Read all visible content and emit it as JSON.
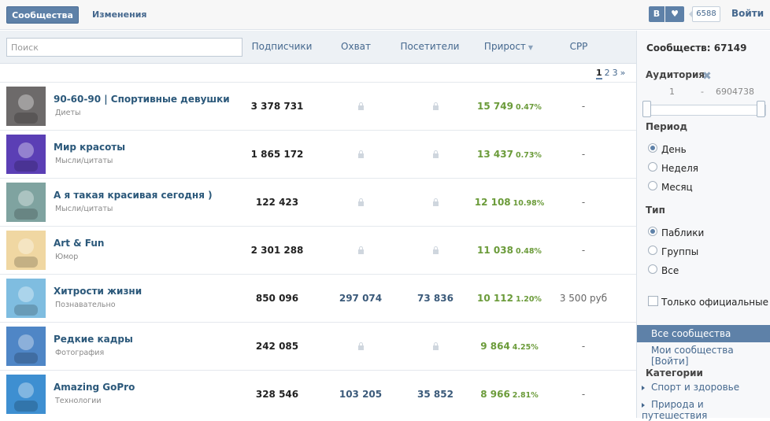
{
  "topbar": {
    "tab_communities": "Сообщества",
    "tab_changes": "Изменения",
    "vk_label": "В",
    "heart": "♥",
    "likes": "6588",
    "login": "Войти"
  },
  "table_header": {
    "search_placeholder": "Поиск",
    "col_subscribers": "Подписчики",
    "col_reach": "Охват",
    "col_visitors": "Посетители",
    "col_growth": "Прирост",
    "sort_indicator": "▼",
    "col_cpp": "CPP"
  },
  "pagination": {
    "pages": [
      "1",
      "2",
      "3"
    ],
    "next": "»",
    "current": "1"
  },
  "rows": [
    {
      "name": "90-60-90 | Спортивные девушки",
      "category": "Диеты",
      "subscribers": "3 378 731",
      "reach": "",
      "visitors": "",
      "growth": "15 749",
      "growth_pct": "0.47%",
      "cpp": "-",
      "thumb_color": "#6d6a6a"
    },
    {
      "name": "Мир красоты",
      "category": "Мысли/цитаты",
      "subscribers": "1 865 172",
      "reach": "",
      "visitors": "",
      "growth": "13 437",
      "growth_pct": "0.73%",
      "cpp": "-",
      "thumb_color": "#5b3fb5"
    },
    {
      "name": "А я такая красивая сегодня )",
      "category": "Мысли/цитаты",
      "subscribers": "122 423",
      "reach": "",
      "visitors": "",
      "growth": "12 108",
      "growth_pct": "10.98%",
      "cpp": "-",
      "thumb_color": "#7fa3a0"
    },
    {
      "name": "Art & Fun",
      "category": "Юмор",
      "subscribers": "2 301 288",
      "reach": "",
      "visitors": "",
      "growth": "11 038",
      "growth_pct": "0.48%",
      "cpp": "-",
      "thumb_color": "#f0d7a2"
    },
    {
      "name": "Хитрости жизни",
      "category": "Познавательно",
      "subscribers": "850 096",
      "reach": "297 074",
      "visitors": "73 836",
      "growth": "10 112",
      "growth_pct": "1.20%",
      "cpp": "3 500 руб",
      "thumb_color": "#7fbde0"
    },
    {
      "name": "Редкие кадры",
      "category": "Фотография",
      "subscribers": "242 085",
      "reach": "",
      "visitors": "",
      "growth": "9 864",
      "growth_pct": "4.25%",
      "cpp": "-",
      "thumb_color": "#4f86c6"
    },
    {
      "name": "Amazing GoPro",
      "category": "Технологии",
      "subscribers": "328 546",
      "reach": "103 205",
      "visitors": "35 852",
      "growth": "8 966",
      "growth_pct": "2.81%",
      "cpp": "-",
      "thumb_color": "#3e8fd1"
    }
  ],
  "sidebar": {
    "total": "Сообществ: 67149",
    "audience_title": "Аудитория",
    "audience_clear": "✖",
    "audience_min": "1",
    "audience_dash": "-",
    "audience_max": "6904738",
    "period_title": "Период",
    "period_options": [
      "День",
      "Неделя",
      "Месяц"
    ],
    "period_selected": "День",
    "type_title": "Тип",
    "type_options": [
      "Паблики",
      "Группы",
      "Все"
    ],
    "type_selected": "Паблики",
    "official_only": "Только официальные",
    "all_communities": "Все сообщества",
    "my_communities": "Мои сообщества [Войти]",
    "categories_title": "Категории",
    "categories": [
      "Спорт и здоровье",
      "Природа и путешествия"
    ]
  },
  "colors": {
    "accent": "#5e81a8",
    "link": "#45688e",
    "growth": "#6b9b3a"
  }
}
